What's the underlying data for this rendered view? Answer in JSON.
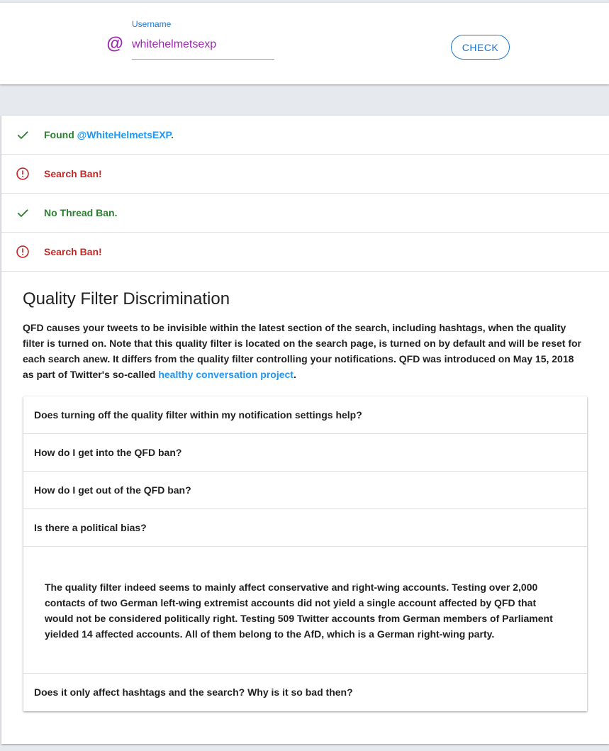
{
  "search": {
    "label": "Username",
    "value": "whitehelmetsexp",
    "at_symbol": "@",
    "button_label": "CHECK"
  },
  "results": [
    {
      "status": "ok",
      "icon": "check-icon",
      "prefix": "Found ",
      "link": "@WhiteHelmetsEXP",
      "suffix": "."
    },
    {
      "status": "bad",
      "icon": "error-icon",
      "text": "Search Ban!"
    },
    {
      "status": "ok",
      "icon": "check-icon",
      "text": "No Thread Ban."
    },
    {
      "status": "bad",
      "icon": "error-icon",
      "text": "Search Ban!"
    }
  ],
  "qfd": {
    "title": "Quality Filter Discrimination",
    "description": "QFD causes your tweets to be invisible within the latest section of the search, including hashtags, when the quality filter is turned on. Note that this quality filter is located on the search page, is turned on by default and will be reset for each search anew. It differs from the quality filter controlling your notifications. QFD was introduced on May 15, 2018 as part of Twitter's so-called ",
    "description_link": "healthy conversation project",
    "description_end": ".",
    "faq": [
      {
        "question": "Does turning off the quality filter within my notification settings help?"
      },
      {
        "question": "How do I get into the QFD ban?"
      },
      {
        "question": "How do I get out of the QFD ban?"
      },
      {
        "question": "Is there a political bias?",
        "answer": "The quality filter indeed seems to mainly affect conservative and right-wing accounts. Testing over 2,000 contacts of two German left-wing extremist accounts did not yield a single account affected by QFD that would not be considered politically right. Testing 509 Twitter accounts from German members of Parliament yielded 14 affected accounts. All of them belong to the AfD, which is a German right-wing party."
      },
      {
        "question": "Does it only affect hashtags and the search? Why is it so bad then?"
      }
    ]
  },
  "colors": {
    "ok": "#2e7d32",
    "bad": "#c62828",
    "link": "#2196f3",
    "accent": "#1976d2",
    "username": "#9c27b0"
  }
}
